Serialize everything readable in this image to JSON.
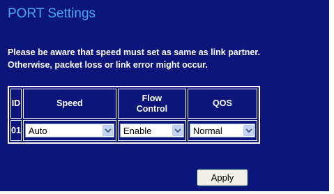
{
  "page": {
    "title": "PORT Settings",
    "notice_line1": "Please be aware that speed must set as same as link partner.",
    "notice_line2": "Otherwise, packet loss or link error might occur."
  },
  "table": {
    "headers": {
      "id": "ID",
      "speed": "Speed",
      "flow_line1": "Flow",
      "flow_line2": "Control",
      "qos": "QOS"
    },
    "rows": [
      {
        "id": "01",
        "speed": "Auto",
        "flow_control": "Enable",
        "qos": "Normal"
      }
    ]
  },
  "actions": {
    "apply_label": "Apply"
  },
  "colors": {
    "background": "#0c167a",
    "title": "#49a7f6",
    "text": "#ffffff"
  },
  "icons": {
    "dropdown": "chevron-down-icon"
  }
}
